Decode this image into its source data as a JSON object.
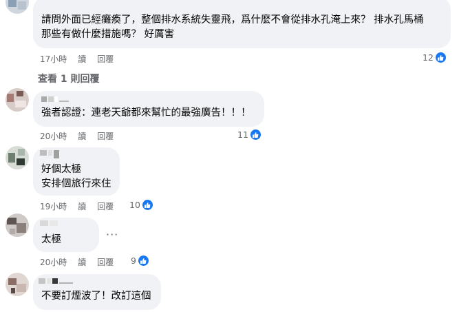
{
  "comments": [
    {
      "text_lines": [
        "請問外面已經癱瘓了，整個排水系統失靈飛，爲什麼不會從排水孔淹上來？ 排水孔馬桶",
        "那些有做什麼措施嗎？ 好厲害"
      ],
      "time": "17小時",
      "reply_label": "讀",
      "action_label": "回覆",
      "like_count": "12"
    },
    {
      "text_lines": [
        "強者認證：連老天爺都來幫忙的最強廣告！！！"
      ],
      "time": "20小時",
      "reply_label": "讀",
      "action_label": "回覆",
      "like_count": "11"
    },
    {
      "text_lines": [
        "好個太極",
        "安排個旅行來住"
      ],
      "time": "19小時",
      "reply_label": "讀",
      "action_label": "回覆",
      "like_count": "10"
    },
    {
      "text_lines": [
        "太極"
      ],
      "time": "20小時",
      "reply_label": "讀",
      "action_label": "回覆",
      "like_count": "9",
      "more_label": "···"
    },
    {
      "text_lines": [
        "不要訂煙波了！改訂這個"
      ]
    }
  ],
  "view_replies": "查看 1 則回覆",
  "colors": {
    "like_blue": "#1877f2",
    "bubble": "#f0f2f5",
    "meta_gray": "#65676b"
  }
}
